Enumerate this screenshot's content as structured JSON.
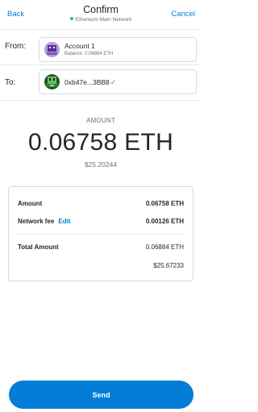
{
  "header": {
    "back_label": "Back",
    "title": "Confirm",
    "network": "Ethereum Main Network",
    "cancel_label": "Cancel"
  },
  "from": {
    "label": "From:",
    "account_name": "Account 1",
    "balance": "Balance: 0.06884 ETH"
  },
  "to": {
    "label": "To:",
    "address": "0xb47e...3BB8",
    "verified_icon": "checkmark-icon"
  },
  "amount": {
    "label": "AMOUNT",
    "value": "0.06758 ETH",
    "usd": "$25.20244"
  },
  "summary": {
    "amount_label": "Amount",
    "amount_value": "0.06758 ETH",
    "fee_label": "Network fee",
    "edit_label": "Edit",
    "fee_value": "0.00126 ETH",
    "total_label": "Total Amount",
    "total_value": "0.06884 ETH",
    "total_usd": "$25.67233"
  },
  "actions": {
    "send_label": "Send"
  },
  "colors": {
    "accent": "#037dd6",
    "network_dot": "#29b6af",
    "verified": "#28a745"
  }
}
